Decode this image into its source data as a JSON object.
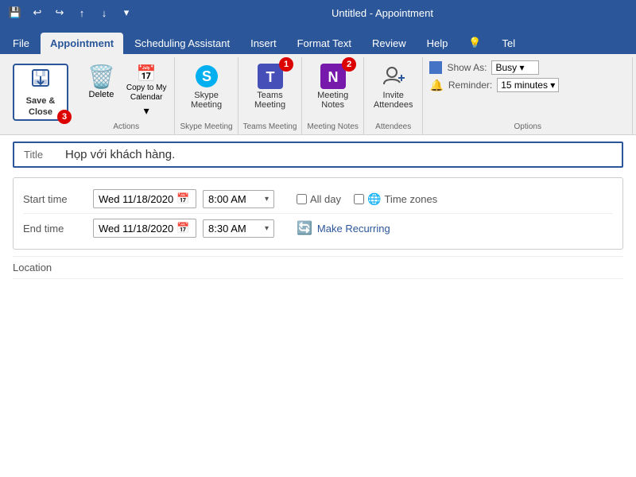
{
  "titleBar": {
    "title": "Untitled - Appointment"
  },
  "tabs": [
    {
      "id": "file",
      "label": "File"
    },
    {
      "id": "appointment",
      "label": "Appointment",
      "active": true
    },
    {
      "id": "scheduling",
      "label": "Scheduling Assistant"
    },
    {
      "id": "insert",
      "label": "Insert"
    },
    {
      "id": "formattext",
      "label": "Format Text"
    },
    {
      "id": "review",
      "label": "Review"
    },
    {
      "id": "help",
      "label": "Help"
    }
  ],
  "ribbon": {
    "groups": {
      "actions": {
        "label": "Actions",
        "delete": "Delete",
        "copyToCalendar": "Copy to My\nCalendar"
      },
      "skypeMeeting": {
        "label": "Skype Meeting",
        "button": "Skype\nMeeting"
      },
      "teamsMeeting": {
        "label": "Teams Meeting",
        "button": "Teams\nMeeting"
      },
      "meetingNotes": {
        "label": "Meeting Notes",
        "button": "Meeting\nNotes"
      },
      "attendees": {
        "label": "Attendees",
        "button": "Invite\nAttendees"
      },
      "options": {
        "label": "Options",
        "showAs": "Show As:",
        "showAsValue": "Busy",
        "reminder": "Reminder:",
        "reminderValue": "15 minutes"
      }
    },
    "saveClose": "Save &\nClose"
  },
  "form": {
    "titleLabel": "Title",
    "titleValue": "Họp với khách hàng.",
    "startTimeLabel": "Start time",
    "startDate": "Wed 11/18/2020",
    "startTime": "8:00 AM",
    "endTimeLabel": "End time",
    "endDate": "Wed 11/18/2020",
    "endTime": "8:30 AM",
    "allDay": "All day",
    "timeZones": "Time zones",
    "makeRecurring": "Make Recurring",
    "locationLabel": "Location"
  },
  "badges": {
    "1": "1",
    "2": "2",
    "3": "3"
  }
}
